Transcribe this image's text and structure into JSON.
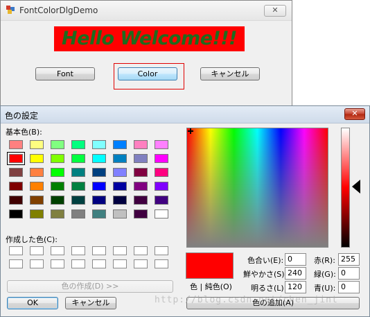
{
  "demo": {
    "title": "FontColorDlgDemo",
    "close_label": "✕",
    "hello_text": "Hello Welcome!!!",
    "buttons": {
      "font": "Font",
      "color": "Color",
      "cancel": "キャンセル"
    }
  },
  "dialog": {
    "title": "色の設定",
    "close_label": "✕",
    "basic_colors_label": "基本色(B):",
    "basic_colors": [
      "#ff8080",
      "#ffff80",
      "#80ff80",
      "#00ff80",
      "#80ffff",
      "#0080ff",
      "#ff80c0",
      "#ff80ff",
      "#ff0000",
      "#ffff00",
      "#80ff00",
      "#00ff40",
      "#00ffff",
      "#0080c0",
      "#8080c0",
      "#ff00ff",
      "#804040",
      "#ff8040",
      "#00ff00",
      "#008080",
      "#004080",
      "#8080ff",
      "#800040",
      "#ff0080",
      "#800000",
      "#ff8000",
      "#008000",
      "#008040",
      "#0000ff",
      "#0000a0",
      "#800080",
      "#8000ff",
      "#400000",
      "#804000",
      "#004000",
      "#004040",
      "#000080",
      "#000040",
      "#400040",
      "#400080",
      "#000000",
      "#808000",
      "#808040",
      "#808080",
      "#408080",
      "#c0c0c0",
      "#400040",
      "#ffffff"
    ],
    "selected_basic_color": "#ff0000",
    "custom_colors_label": "作成した色(C):",
    "define_custom_button": "色の作成(D) >>",
    "ok_button": "OK",
    "cancel_button": "キャンセル",
    "color_solid_label": "色 | 純色(O)",
    "hue_label": "色合い(E):",
    "hue_value": "0",
    "sat_label": "鮮やかさ(S):",
    "sat_value": "240",
    "lum_label": "明るさ(L):",
    "lum_value": "120",
    "red_label": "赤(R):",
    "red_value": "255",
    "green_label": "緑(G):",
    "green_value": "0",
    "blue_label": "青(U):",
    "blue_value": "0",
    "add_custom_button": "色の追加(A)",
    "current_color": "#ff0000"
  },
  "watermark": "http://blog.csdn.net/chen_jint"
}
